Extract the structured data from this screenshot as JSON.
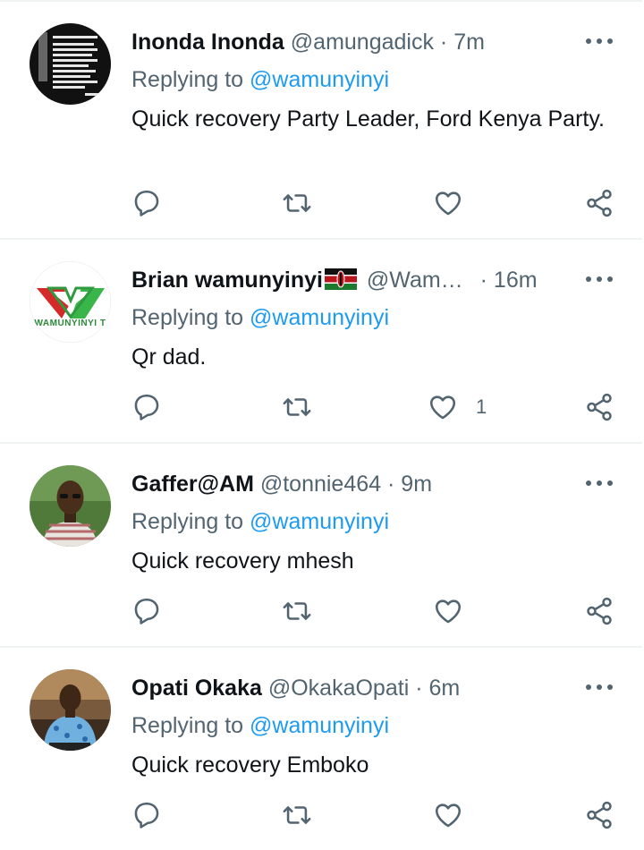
{
  "tweets": [
    {
      "name": "Inonda Inonda",
      "handle": "@amungadick",
      "time": "7m",
      "replying_prefix": "Replying to ",
      "mention": "@wamunyinyi",
      "text": "Quick recovery Party Leader, Ford Kenya Party.",
      "like_count": ""
    },
    {
      "name": "Brian wamunyinyi",
      "handle": "@Wam…",
      "time": "16m",
      "replying_prefix": "Replying to ",
      "mention": "@wamunyinyi",
      "text": "Qr dad.",
      "like_count": "1",
      "avatar_caption": "WAMUNYINYI T"
    },
    {
      "name": "Gaffer@AM",
      "handle": "@tonnie464",
      "time": "9m",
      "replying_prefix": "Replying to ",
      "mention": "@wamunyinyi",
      "text": "Quick recovery mhesh",
      "like_count": ""
    },
    {
      "name": "Opati Okaka",
      "handle": "@OkakaOpati",
      "time": "6m",
      "replying_prefix": "Replying to ",
      "mention": "@wamunyinyi",
      "text": "Quick recovery Emboko",
      "like_count": ""
    }
  ],
  "separator": "·",
  "colors": {
    "text": "#0f1419",
    "muted": "#536471",
    "link": "#1d9bf0",
    "divider": "#eff3f4"
  },
  "icons": [
    "more-icon",
    "reply-icon",
    "retweet-icon",
    "like-icon",
    "share-icon",
    "kenya-flag-icon"
  ]
}
